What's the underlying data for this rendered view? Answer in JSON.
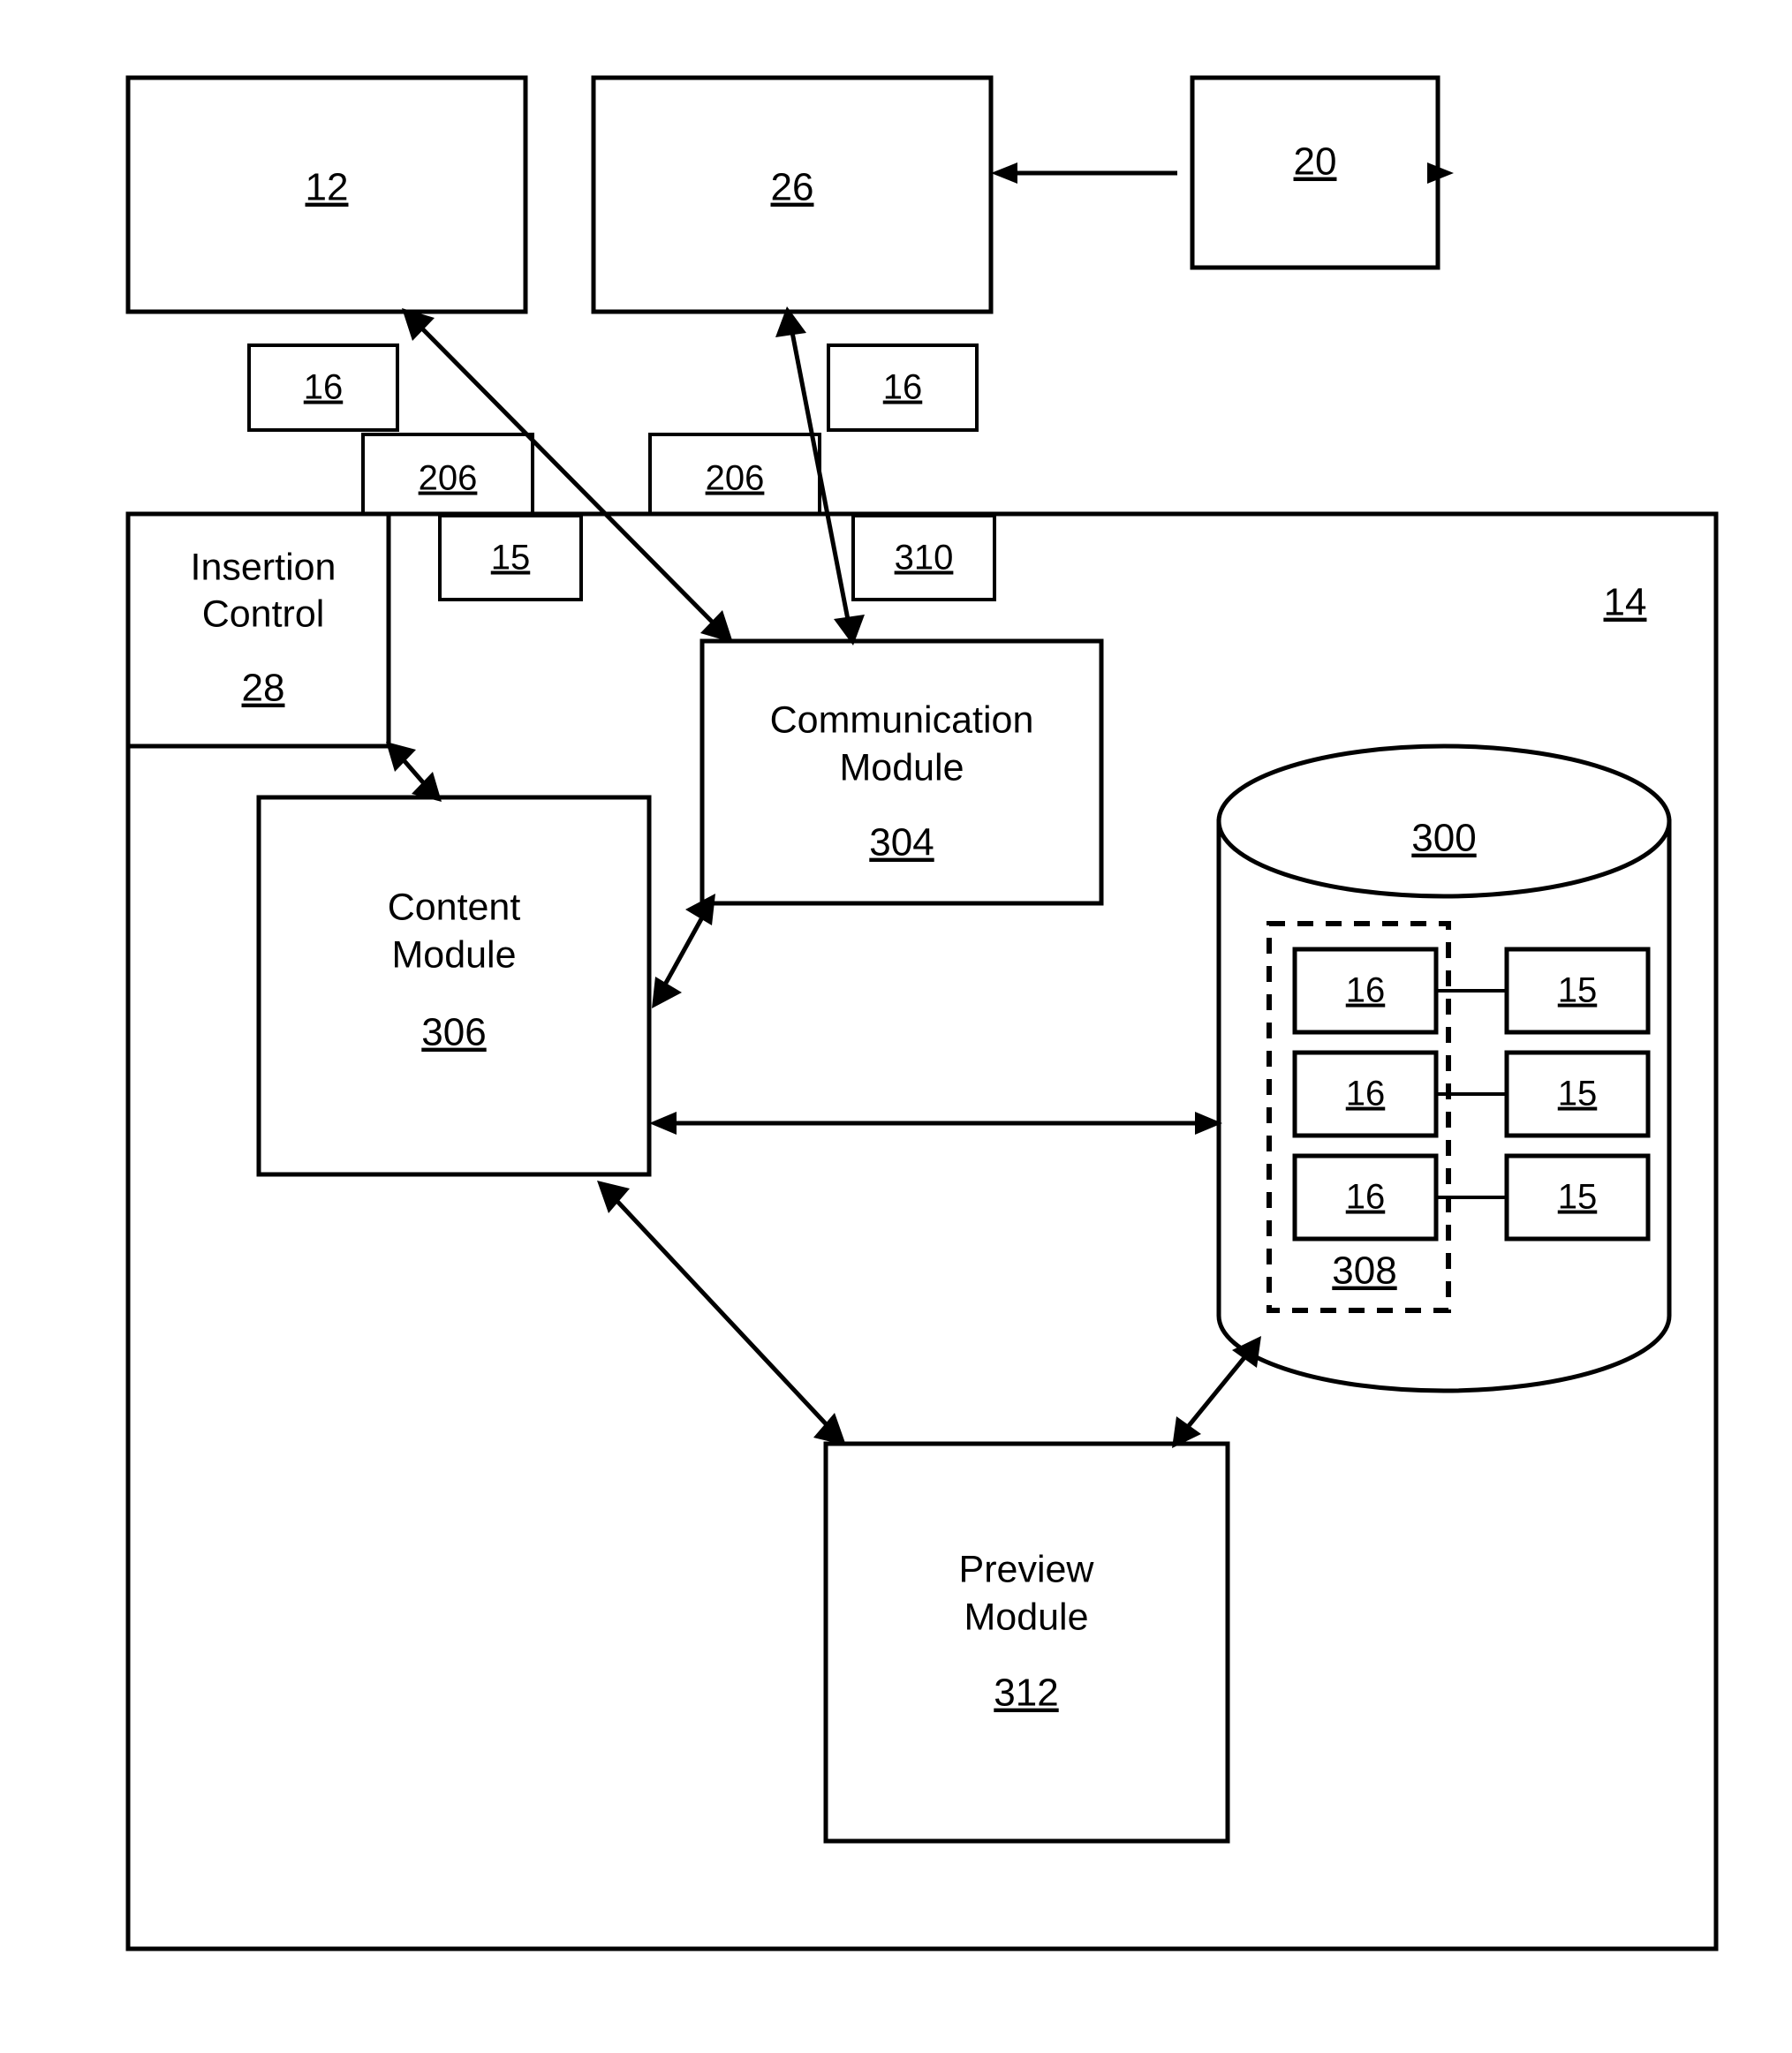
{
  "figure": {
    "title": "System block diagram",
    "background_color": "#ffffff",
    "line_color": "#000000"
  },
  "top_boxes": [
    {
      "id": "box-12",
      "ref": "12"
    },
    {
      "id": "box-26",
      "ref": "26"
    },
    {
      "id": "box-20",
      "ref": "20"
    }
  ],
  "callouts": [
    {
      "id": "callout-16-left",
      "ref": "16"
    },
    {
      "id": "callout-16-right",
      "ref": "16"
    },
    {
      "id": "callout-206-left",
      "ref": "206"
    },
    {
      "id": "callout-206-right",
      "ref": "206"
    },
    {
      "id": "callout-15",
      "ref": "15"
    },
    {
      "id": "callout-310",
      "ref": "310"
    }
  ],
  "container": {
    "ref": "14"
  },
  "insertion_control": {
    "line1": "Insertion",
    "line2": "Control",
    "ref": "28"
  },
  "modules": [
    {
      "id": "communication-module",
      "line1": "Communication",
      "line2": "Module",
      "ref": "304"
    },
    {
      "id": "content-module",
      "line1": "Content",
      "line2": "Module",
      "ref": "306"
    },
    {
      "id": "preview-module",
      "line1": "Preview",
      "line2": "Module",
      "ref": "312"
    }
  ],
  "database": {
    "id": "database-cylinder",
    "ref": "300",
    "group_ref": "308",
    "rows": [
      {
        "left_ref": "16",
        "right_ref": "15"
      },
      {
        "left_ref": "16",
        "right_ref": "15"
      },
      {
        "left_ref": "16",
        "right_ref": "15"
      }
    ]
  }
}
